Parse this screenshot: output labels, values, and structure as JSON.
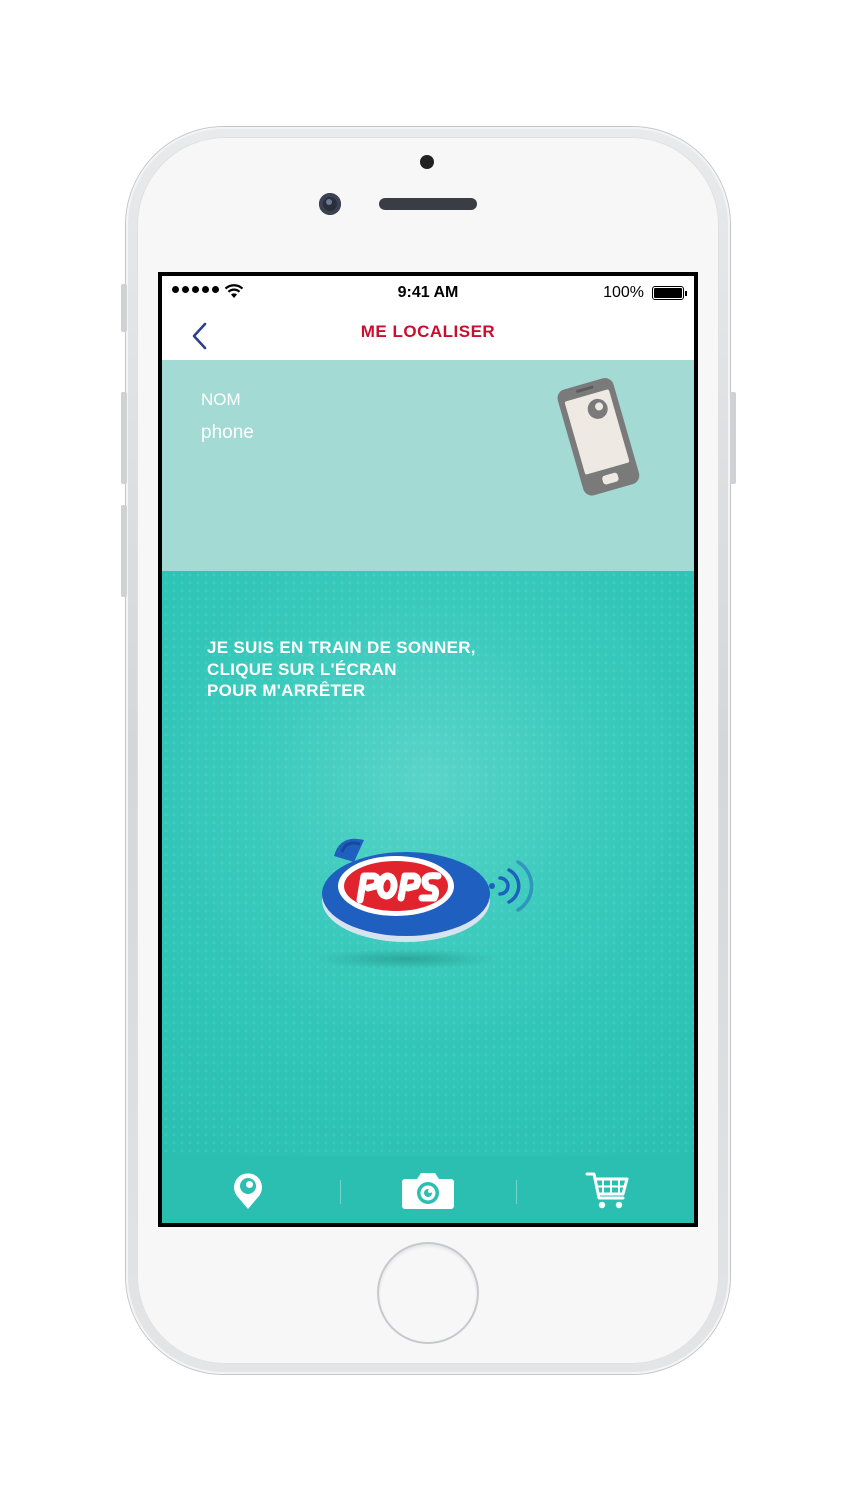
{
  "status_bar": {
    "time": "9:41 AM",
    "battery": "100%"
  },
  "nav": {
    "title": "ME LOCALISER"
  },
  "device": {
    "name_label": "NOM",
    "name_value": "phone"
  },
  "message": {
    "lines": [
      "JE SUIS EN TRAIN DE SONNER,",
      "CLIQUE SUR L'ÉCRAN",
      "POUR M'ARRÊTER"
    ]
  },
  "tabs": [
    {
      "icon": "location-pin-icon"
    },
    {
      "icon": "camera-icon"
    },
    {
      "icon": "cart-icon"
    }
  ],
  "colors": {
    "accent_red": "#c8102e",
    "header_teal": "#a3dbd4",
    "main_teal": "#2ec4b6",
    "tab_teal": "#2abfb1",
    "tag_blue": "#1f5fbf"
  }
}
